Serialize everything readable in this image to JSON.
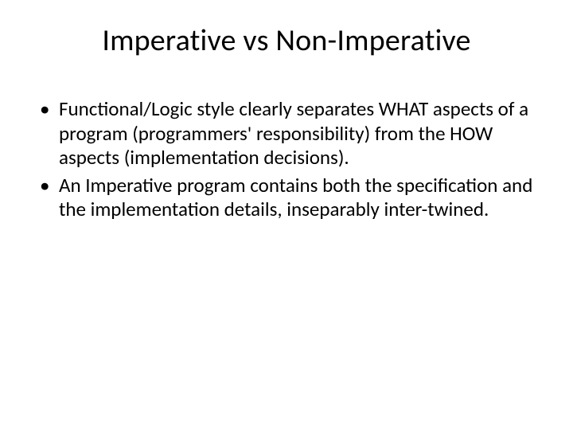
{
  "slide": {
    "title": "Imperative vs Non-Imperative",
    "bullets": [
      "Functional/Logic style clearly separates WHAT aspects of a program (programmers' responsibility) from the HOW aspects (implementation decisions).",
      "An Imperative program contains both the specification and the implementation details, inseparably inter-twined."
    ]
  }
}
